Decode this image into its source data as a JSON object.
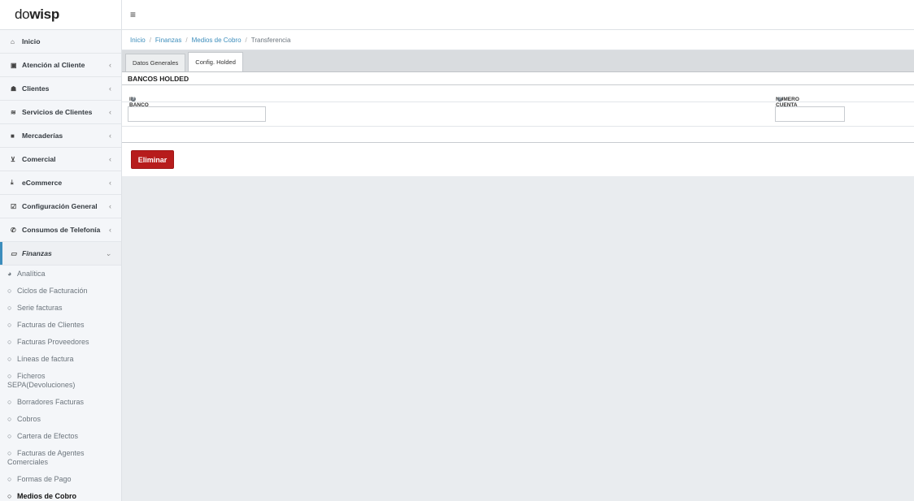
{
  "brand": {
    "logo_light": "do",
    "logo_bold": "wisp"
  },
  "sidebar": {
    "items": [
      {
        "name": "inicio",
        "icon": "home-icon",
        "glyph": "⌂",
        "label": "Inicio",
        "chevron": ""
      },
      {
        "name": "atencion-al-cliente",
        "icon": "calendar-icon",
        "glyph": "▣",
        "label": "Atención al Cliente",
        "chevron": "‹"
      },
      {
        "name": "clientes",
        "icon": "users-icon",
        "glyph": "☗",
        "label": "Clientes",
        "chevron": "‹"
      },
      {
        "name": "servicios-de-clientes",
        "icon": "wifi-icon",
        "glyph": "≋",
        "label": "Servicios de Clientes",
        "chevron": "‹"
      },
      {
        "name": "mercaderias",
        "icon": "truck-icon",
        "glyph": "■",
        "label": "Mercaderías",
        "chevron": "‹"
      },
      {
        "name": "comercial",
        "icon": "cart-icon",
        "glyph": "⊻",
        "label": "Comercial",
        "chevron": "‹"
      },
      {
        "name": "ecommerce",
        "icon": "download-icon",
        "glyph": "⤓",
        "label": "eCommerce",
        "chevron": "‹"
      },
      {
        "name": "configuracion-general",
        "icon": "checklist-icon",
        "glyph": "☑",
        "label": "Configuración General",
        "chevron": "‹"
      },
      {
        "name": "consumos-de-telefonia",
        "icon": "phone-icon",
        "glyph": "✆",
        "label": "Consumos de Telefonía",
        "chevron": "‹"
      },
      {
        "name": "finanzas",
        "icon": "money-icon",
        "glyph": "▭",
        "label": "Finanzas",
        "chevron": "⌄"
      }
    ],
    "subitems": [
      {
        "name": "analitica",
        "icon": "pie-chart-icon",
        "glyph": "◕",
        "label": "Analítica"
      },
      {
        "name": "ciclos-de-facturacion",
        "icon": "circle-icon",
        "glyph": "○",
        "label": "Ciclos de Facturación"
      },
      {
        "name": "serie-facturas",
        "icon": "circle-icon",
        "glyph": "○",
        "label": "Serie facturas"
      },
      {
        "name": "facturas-de-clientes",
        "icon": "circle-icon",
        "glyph": "○",
        "label": "Facturas de Clientes"
      },
      {
        "name": "facturas-proveedores",
        "icon": "circle-icon",
        "glyph": "○",
        "label": "Facturas Proveedores"
      },
      {
        "name": "lineas-de-factura",
        "icon": "circle-icon",
        "glyph": "○",
        "label": "Líneas de factura"
      },
      {
        "name": "ficheros-sepa",
        "icon": "circle-icon",
        "glyph": "○",
        "label": "Ficheros",
        "label2": "SEPA(Devoluciones)"
      },
      {
        "name": "borradores-facturas",
        "icon": "circle-icon",
        "glyph": "○",
        "label": "Borradores Facturas"
      },
      {
        "name": "cobros",
        "icon": "circle-icon",
        "glyph": "○",
        "label": "Cobros"
      },
      {
        "name": "cartera-de-efectos",
        "icon": "circle-icon",
        "glyph": "○",
        "label": "Cartera de Efectos"
      },
      {
        "name": "facturas-agentes-comerciales",
        "icon": "circle-icon",
        "glyph": "○",
        "label": "Facturas de Agentes",
        "label2": "Comerciales"
      },
      {
        "name": "formas-de-pago",
        "icon": "circle-icon",
        "glyph": "○",
        "label": "Formas de Pago"
      },
      {
        "name": "medios-de-cobro",
        "icon": "circle-icon",
        "glyph": "○",
        "label": "Medios de Cobro"
      }
    ]
  },
  "topbar": {
    "menu_glyph": "≡"
  },
  "breadcrumb": {
    "sep": "/",
    "inicio": "Inicio",
    "finanzas": "Finanzas",
    "medios": "Medios de Cobro",
    "current": "Transferencia"
  },
  "tabs": {
    "datos": "Datos Generales",
    "config": "Config. Holded"
  },
  "section": {
    "title": "BANCOS HOLDED"
  },
  "columns": {
    "id_banco": "ID BANCO EN HOLDED",
    "numero_cuenta": "NUMERO CUENTA",
    "help_glyph": "?"
  },
  "form": {
    "id_banco_value": "",
    "numero_cuenta_value": ""
  },
  "actions": {
    "delete_label": "Eliminar"
  },
  "colors": {
    "accent": "#3c8dbc",
    "danger": "#b71c1c"
  }
}
